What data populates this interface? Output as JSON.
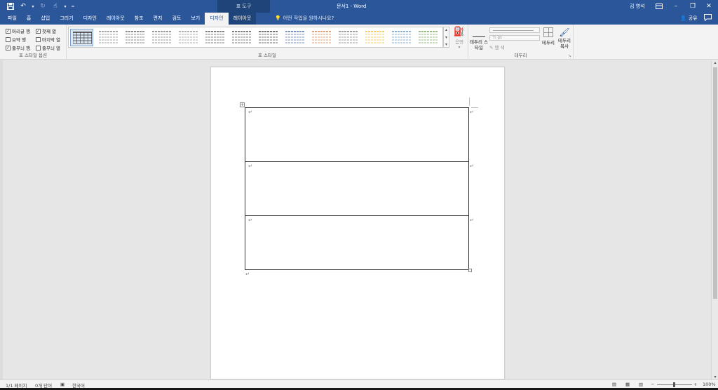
{
  "titlebar": {
    "context_tab_header": "표 도구",
    "document_title": "문서1  -  Word",
    "user_name": "김 영석"
  },
  "ribbon_tabs": [
    {
      "label": "파일"
    },
    {
      "label": "홈"
    },
    {
      "label": "삽입"
    },
    {
      "label": "그리기"
    },
    {
      "label": "디자인"
    },
    {
      "label": "레이아웃"
    },
    {
      "label": "참조"
    },
    {
      "label": "편지"
    },
    {
      "label": "검토"
    },
    {
      "label": "보기"
    },
    {
      "label": "디자인"
    },
    {
      "label": "레이아웃"
    }
  ],
  "tellme": {
    "text": "어떤 작업을 원하시나요?"
  },
  "share": {
    "label": "공유"
  },
  "table_style_options": {
    "group_label": "표 스타일 옵션",
    "header_row": {
      "label": "머리글 행",
      "checked": true
    },
    "first_column": {
      "label": "첫째 열",
      "checked": true
    },
    "total_row": {
      "label": "요약 행",
      "checked": false
    },
    "last_column": {
      "label": "마지막 열",
      "checked": false
    },
    "banded_rows": {
      "label": "줄무늬 행",
      "checked": true
    },
    "banded_columns": {
      "label": "줄무늬 열",
      "checked": false
    }
  },
  "table_styles": {
    "group_label": "표 스타일",
    "thumb_colors": [
      "#333333",
      "#888888",
      "#666666",
      "#777777",
      "#999999",
      "#555555",
      "#555555",
      "#444444",
      "#4472c4",
      "#ed7d31",
      "#7f7f7f",
      "#ffc000",
      "#5b9bd5",
      "#70ad47"
    ],
    "shading_label": "음영"
  },
  "borders": {
    "group_label": "테두리",
    "border_styles_label": "테두리 스타일",
    "weight_value": "½ pt",
    "pen_color_label": "펜 색",
    "borders_button_label": "테두리",
    "border_painter_label": "테두리 복사"
  },
  "status": {
    "page": "1/1 페이지",
    "words": "0개 단어",
    "language": "한국어",
    "zoom": "100%"
  },
  "document": {
    "paragraph_mark": "↵",
    "table_rows": 3
  }
}
